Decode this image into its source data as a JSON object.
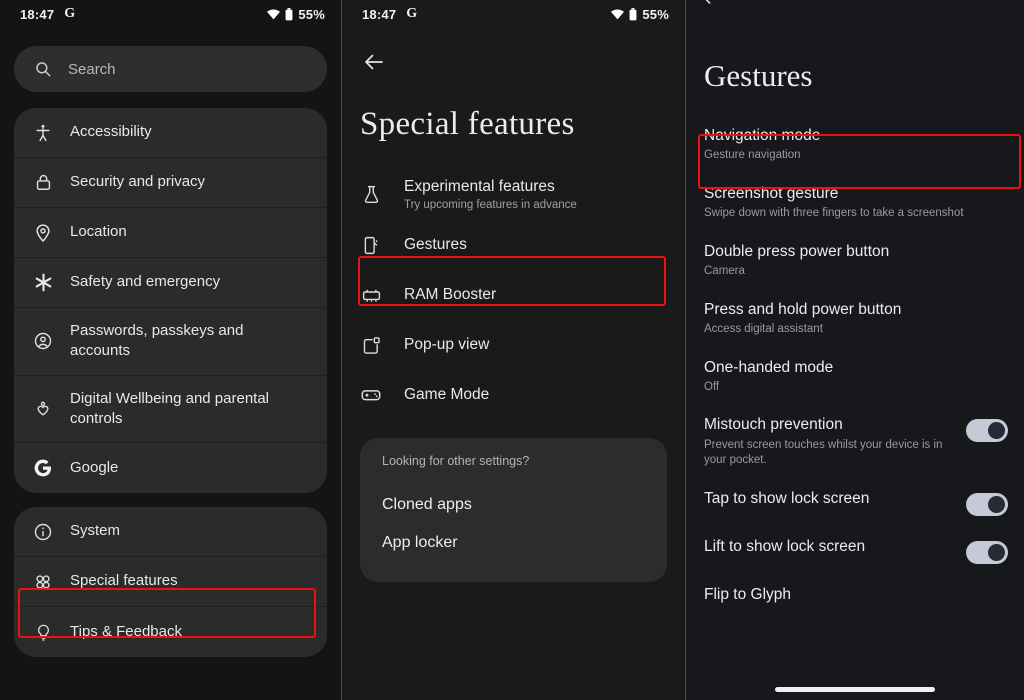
{
  "status_bar": {
    "time": "18:47",
    "assistant_badge": "G",
    "battery_percent": "55%"
  },
  "panel_settings": {
    "search": {
      "placeholder": "Search"
    },
    "group_1": [
      {
        "label": "Accessibility",
        "icon": "accessibility-icon"
      },
      {
        "label": "Security and privacy",
        "icon": "lock-icon"
      },
      {
        "label": "Location",
        "icon": "location-pin-icon"
      },
      {
        "label": "Safety and emergency",
        "icon": "asterisk-icon"
      },
      {
        "label": "Passwords, passkeys and accounts",
        "icon": "account-circle-icon"
      },
      {
        "label": "Digital Wellbeing and parental controls",
        "icon": "wellbeing-heart-icon"
      },
      {
        "label": "Google",
        "icon": "google-g-icon"
      }
    ],
    "group_2": [
      {
        "label": "System",
        "icon": "info-circle-icon"
      },
      {
        "label": "Special features",
        "icon": "special-features-icon",
        "highlighted": true
      },
      {
        "label": "Tips & Feedback",
        "icon": "lightbulb-icon"
      }
    ]
  },
  "panel_special_features": {
    "title": "Special features",
    "back_label": "Back",
    "items": [
      {
        "label": "Experimental features",
        "sub": "Try upcoming features in advance",
        "icon": "flask-icon"
      },
      {
        "label": "Gestures",
        "sub": "",
        "icon": "gestures-phone-icon",
        "highlighted": true
      },
      {
        "label": "RAM Booster",
        "sub": "",
        "icon": "ram-chip-icon"
      },
      {
        "label": "Pop-up view",
        "sub": "",
        "icon": "popup-window-icon"
      },
      {
        "label": "Game Mode",
        "sub": "",
        "icon": "gamepad-icon"
      }
    ],
    "other_settings": {
      "heading": "Looking for other settings?",
      "items": [
        "Cloned apps",
        "App locker"
      ]
    }
  },
  "panel_gestures": {
    "title": "Gestures",
    "back_label": "Back",
    "items": [
      {
        "label": "Navigation mode",
        "sub": "Gesture navigation",
        "toggle": null,
        "highlighted": true
      },
      {
        "label": "Screenshot gesture",
        "sub": "Swipe down with three fingers to take a screenshot",
        "toggle": null
      },
      {
        "label": "Double press power button",
        "sub": "Camera",
        "toggle": null
      },
      {
        "label": "Press and hold power button",
        "sub": "Access digital assistant",
        "toggle": null
      },
      {
        "label": "One-handed mode",
        "sub": "Off",
        "toggle": null
      },
      {
        "label": "Mistouch prevention",
        "sub": "Prevent screen touches whilst your device is in your pocket.",
        "toggle": "on"
      },
      {
        "label": "Tap to show lock screen",
        "sub": "",
        "toggle": "on"
      },
      {
        "label": "Lift to show lock screen",
        "sub": "",
        "toggle": "on"
      },
      {
        "label": "Flip to Glyph",
        "sub": "",
        "toggle": null
      }
    ]
  },
  "colors": {
    "highlight": "#ee1111",
    "toggle_on_track": "#c6cad6",
    "toggle_knob": "#272b36"
  }
}
